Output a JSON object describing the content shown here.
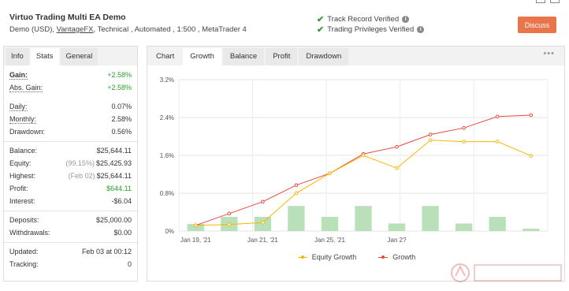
{
  "header": {
    "title": "Virtuo Trading Multi EA Demo",
    "account_type": "Demo (USD),",
    "broker_link": "VantageFX",
    "details": ", Technical , Automated , 1:500 , MetaTrader 4",
    "track_record": "Track Record Verified",
    "trading_privileges": "Trading Privileges Verified",
    "discuss_label": "Discuss"
  },
  "left_tabs": [
    "Info",
    "Stats",
    "General"
  ],
  "stats": {
    "gain_label": "Gain:",
    "gain_value": "+2.58%",
    "abs_gain_label": "Abs. Gain:",
    "abs_gain_value": "+2.58%",
    "daily_label": "Daily:",
    "daily_value": "0.07%",
    "monthly_label": "Monthly:",
    "monthly_value": "2.58%",
    "drawdown_label": "Drawdown:",
    "drawdown_value": "0.56%",
    "balance_label": "Balance:",
    "balance_value": "$25,644.11",
    "equity_label": "Equity:",
    "equity_note": "(99.15%)",
    "equity_value": "$25,425.93",
    "highest_label": "Highest:",
    "highest_note": "(Feb 02)",
    "highest_value": "$25,644.11",
    "profit_label": "Profit:",
    "profit_value": "$644.11",
    "interest_label": "Interest:",
    "interest_value": "-$6.04",
    "deposits_label": "Deposits:",
    "deposits_value": "$25,000.00",
    "withdrawals_label": "Withdrawals:",
    "withdrawals_value": "$0.00",
    "updated_label": "Updated:",
    "updated_value": "Feb 03 at 00:12",
    "tracking_label": "Tracking:",
    "tracking_value": "0"
  },
  "right_tabs": [
    "Chart",
    "Growth",
    "Balance",
    "Profit",
    "Drawdown"
  ],
  "more_label": "•••",
  "chart_data": {
    "type": "line",
    "y_ticks": [
      "3.2%",
      "2.4%",
      "1.6%",
      "0.8%",
      "0%"
    ],
    "ylim": [
      0,
      3.2
    ],
    "x_ticks": [
      "Jan 19, '21",
      "Jan 21, '21",
      "Jan 25, '21",
      "Jan 2?"
    ],
    "grid": true,
    "legend_position": "bottom",
    "series": [
      {
        "name": "Equity Growth",
        "color": "#f5b800",
        "values": [
          0.12,
          0.14,
          0.18,
          0.8,
          1.22,
          1.6,
          1.33,
          1.92,
          1.89,
          1.89,
          1.59
        ]
      },
      {
        "name": "Growth",
        "color": "#e8483a",
        "values": [
          0.12,
          0.37,
          0.62,
          0.97,
          1.22,
          1.63,
          1.78,
          2.04,
          2.18,
          2.42,
          2.45
        ]
      }
    ],
    "bars": {
      "color": "#b9e0b9",
      "values": [
        0.15,
        0.3,
        0.3,
        0.53,
        0.3,
        0.53,
        0.16,
        0.53,
        0.16,
        0.3,
        0.05
      ]
    }
  },
  "legend": {
    "equity_label": "Equity Growth",
    "growth_label": "Growth"
  }
}
